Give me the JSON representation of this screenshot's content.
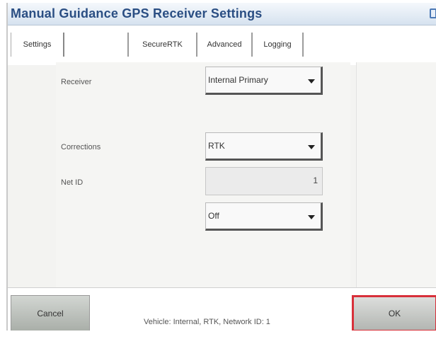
{
  "window": {
    "title": "Manual Guidance GPS Receiver Settings"
  },
  "tabs": [
    {
      "label": "Settings",
      "active": true
    },
    {
      "label": "",
      "active": false
    },
    {
      "label": "SecureRTK",
      "active": false
    },
    {
      "label": "Advanced",
      "active": false
    },
    {
      "label": "Logging",
      "active": false
    }
  ],
  "form": {
    "receiver": {
      "label": "Receiver",
      "value": "Internal Primary"
    },
    "corrections": {
      "label": "Corrections",
      "value": "RTK"
    },
    "net_id": {
      "label": "Net ID",
      "value": "1"
    },
    "faded_field": {
      "label": "",
      "value": "Off"
    }
  },
  "footer": {
    "cancel_label": "Cancel",
    "status_text": "Vehicle: Internal, RTK, Network ID: 1",
    "ok_label": "OK"
  },
  "colors": {
    "title_text": "#2a4e83",
    "ok_outline": "#d8303a"
  }
}
